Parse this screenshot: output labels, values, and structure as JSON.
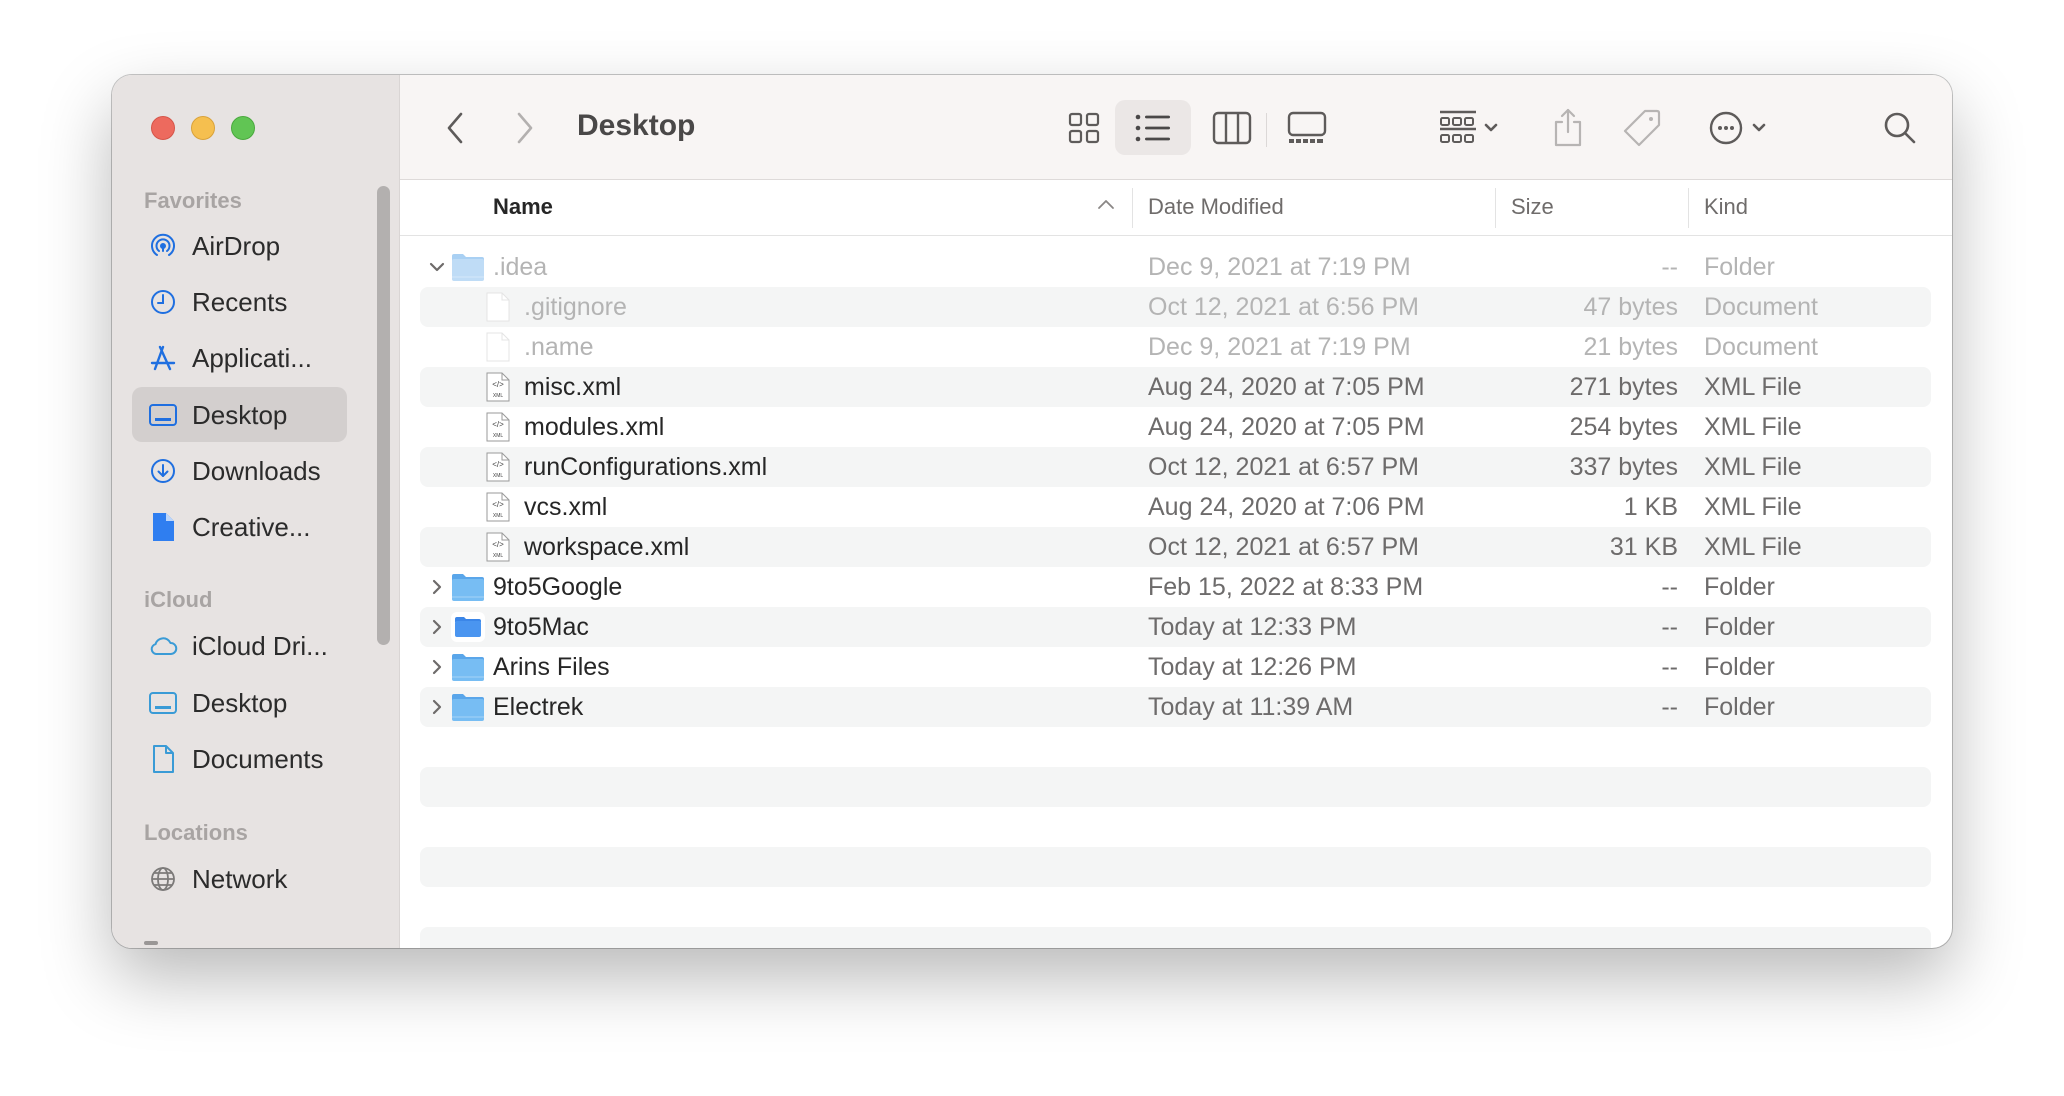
{
  "window": {
    "title": "Desktop",
    "traffic_lights": [
      "close",
      "minimize",
      "zoom"
    ]
  },
  "sidebar": {
    "sections": [
      {
        "label": "Favorites",
        "items": [
          {
            "label": "AirDrop",
            "icon": "airdrop-icon"
          },
          {
            "label": "Recents",
            "icon": "clock-icon"
          },
          {
            "label": "Applicati...",
            "icon": "applications-icon"
          },
          {
            "label": "Desktop",
            "icon": "desktop-icon",
            "selected": true
          },
          {
            "label": "Downloads",
            "icon": "download-icon"
          },
          {
            "label": "Creative...",
            "icon": "document-filled-icon"
          }
        ]
      },
      {
        "label": "iCloud",
        "items": [
          {
            "label": "iCloud Dri...",
            "icon": "cloud-icon"
          },
          {
            "label": "Desktop",
            "icon": "desktop-icon"
          },
          {
            "label": "Documents",
            "icon": "document-icon"
          }
        ]
      },
      {
        "label": "Locations",
        "items": [
          {
            "label": "Network",
            "icon": "globe-icon"
          }
        ]
      }
    ]
  },
  "toolbar": {
    "back": "back",
    "forward": "forward",
    "view_modes": [
      "icons",
      "list",
      "columns",
      "gallery"
    ],
    "selected_view": "list",
    "group_label": "group",
    "share_label": "share",
    "tag_label": "tags",
    "more_label": "more",
    "search_label": "search"
  },
  "columns": {
    "name": "Name",
    "date": "Date Modified",
    "size": "Size",
    "kind": "Kind",
    "sort": "ascending"
  },
  "rows": [
    {
      "name": ".idea",
      "date": "Dec 9, 2021 at 7:19 PM",
      "size": "--",
      "kind": "Folder",
      "type": "folder-light",
      "expanded": true,
      "level": 0,
      "hidden": true
    },
    {
      "name": ".gitignore",
      "date": "Oct 12, 2021 at 6:56 PM",
      "size": "47 bytes",
      "kind": "Document",
      "type": "doc",
      "level": 1,
      "hidden": true
    },
    {
      "name": ".name",
      "date": "Dec 9, 2021 at 7:19 PM",
      "size": "21 bytes",
      "kind": "Document",
      "type": "doc",
      "level": 1,
      "hidden": true
    },
    {
      "name": "misc.xml",
      "date": "Aug 24, 2020 at 7:05 PM",
      "size": "271 bytes",
      "kind": "XML File",
      "type": "xml",
      "level": 1
    },
    {
      "name": "modules.xml",
      "date": "Aug 24, 2020 at 7:05 PM",
      "size": "254 bytes",
      "kind": "XML File",
      "type": "xml",
      "level": 1
    },
    {
      "name": "runConfigurations.xml",
      "date": "Oct 12, 2021 at 6:57 PM",
      "size": "337 bytes",
      "kind": "XML File",
      "type": "xml",
      "level": 1
    },
    {
      "name": "vcs.xml",
      "date": "Aug 24, 2020 at 7:06 PM",
      "size": "1 KB",
      "kind": "XML File",
      "type": "xml",
      "level": 1
    },
    {
      "name": "workspace.xml",
      "date": "Oct 12, 2021 at 6:57 PM",
      "size": "31 KB",
      "kind": "XML File",
      "type": "xml",
      "level": 1
    },
    {
      "name": "9to5Google",
      "date": "Feb 15, 2022 at 8:33 PM",
      "size": "--",
      "kind": "Folder",
      "type": "folder",
      "expanded": false,
      "level": 0
    },
    {
      "name": "9to5Mac",
      "date": "Today at 12:33 PM",
      "size": "--",
      "kind": "Folder",
      "type": "folder-custom",
      "expanded": false,
      "level": 0
    },
    {
      "name": "Arins Files",
      "date": "Today at 12:26 PM",
      "size": "--",
      "kind": "Folder",
      "type": "folder",
      "expanded": false,
      "level": 0
    },
    {
      "name": "Electrek",
      "date": "Today at 11:39 AM",
      "size": "--",
      "kind": "Folder",
      "type": "folder",
      "expanded": false,
      "level": 0
    }
  ],
  "colors": {
    "accent": "#1a73e8",
    "sidebar_icon": "#1f6fe0",
    "icloud_icon": "#3a9bd6",
    "folder": "#6fb6ef"
  }
}
